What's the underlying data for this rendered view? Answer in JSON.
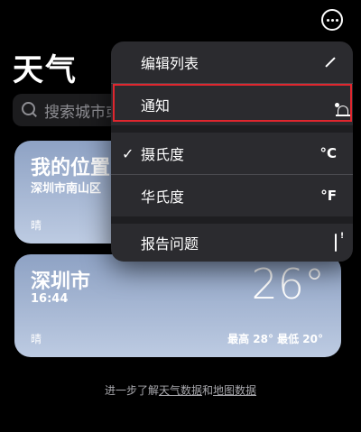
{
  "header": {
    "title": "天气"
  },
  "search": {
    "placeholder": "搜索城市或"
  },
  "cards": [
    {
      "name": "我的位置",
      "sub": "深圳市南山区",
      "condition": "晴"
    },
    {
      "name": "深圳市",
      "sub": "16:44",
      "condition": "晴",
      "temperature": "26°",
      "hilo": "最高 28°  最低 20°"
    }
  ],
  "footer": {
    "prefix": "进一步了解",
    "link": "天气数据",
    "middle": "和",
    "link2": "地图数据"
  },
  "menu": {
    "edit_list": "编辑列表",
    "notifications": "通知",
    "celsius": "摄氏度",
    "celsius_unit": "°C",
    "celsius_checked": "✓",
    "fahrenheit": "华氏度",
    "fahrenheit_unit": "°F",
    "report": "报告问题"
  },
  "colors": {
    "highlight": "#e0262e",
    "menu_bg": "#2b2b2f",
    "card": "#8ea2c4"
  }
}
